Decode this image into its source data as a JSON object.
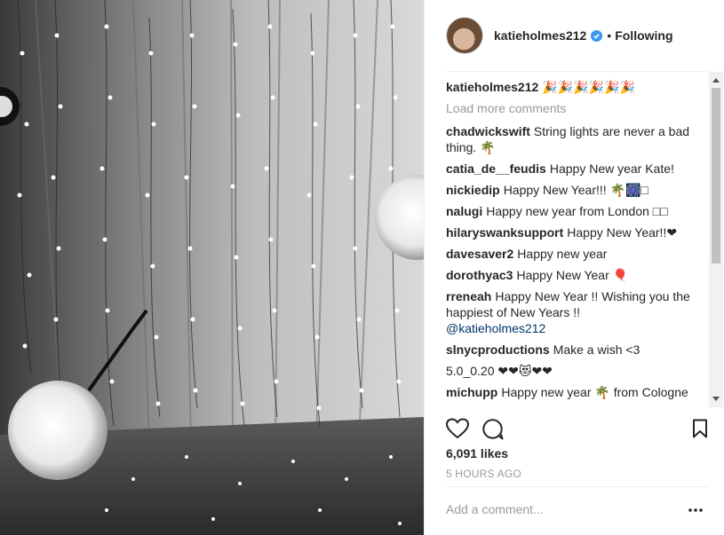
{
  "post": {
    "username": "katieholmes212",
    "separator": "•",
    "follow_state": "Following",
    "photo_alt": "String lights hanging from a ceiling with glowing globe ornaments",
    "caption": {
      "user": "katieholmes212",
      "text": "🎉🎉🎉🎉🎉🎉"
    },
    "load_more_label": "Load more comments",
    "comments": [
      {
        "user": "chadwickswift",
        "text": "String lights are never a bad thing. 🌴"
      },
      {
        "user": "catia_de__feudis",
        "text": "Happy New year Kate!"
      },
      {
        "user": "nickiedip",
        "text": "Happy New Year!!! 🌴🎆□"
      },
      {
        "user": "nalugi",
        "text": "Happy new year from London □□"
      },
      {
        "user": "hilaryswanksupport",
        "text": "Happy New Year!!❤"
      },
      {
        "user": "davesaver2",
        "text": "Happy new year"
      },
      {
        "user": "dorothyac3",
        "text": "Happy New Year 🎈"
      },
      {
        "user": "rreneah",
        "text": "Happy New Year !! Wishing you the happiest of New Years !!",
        "mention": "@katieholmes212"
      },
      {
        "user": "slnycproductions",
        "text": "Make a wish <3"
      },
      {
        "user": "",
        "text": "5.0_0.20 ❤❤😻❤❤"
      },
      {
        "user": "michupp",
        "text": "Happy new year 🌴 from Cologne"
      }
    ],
    "likes": "6,091 likes",
    "time_ago": "5 HOURS AGO",
    "add_comment_placeholder": "Add a comment...",
    "more_label": "•••"
  },
  "colors": {
    "text": "#262626",
    "muted": "#999999",
    "verified": "#3897f0",
    "mention": "#003569",
    "divider": "#efefef"
  },
  "icons": [
    "verified-icon",
    "heart-icon",
    "comment-icon",
    "bookmark-icon",
    "more-options-icon",
    "scroll-up-icon",
    "scroll-down-icon"
  ]
}
